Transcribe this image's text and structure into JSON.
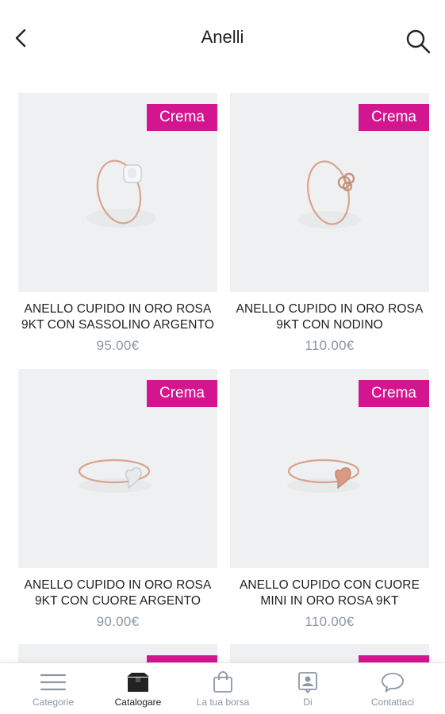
{
  "header": {
    "title": "Anelli",
    "back_icon": "chevron-left-icon",
    "search_icon": "search-icon"
  },
  "colors": {
    "badge": "#d3168f",
    "price": "#8b97a3",
    "image_bg": "#eef0f2"
  },
  "products": [
    {
      "name": "ANELLO CUPIDO IN ORO ROSA 9KT CON SASSOLINO ARGENTO",
      "price": "95.00€",
      "badge": "Crema",
      "charm": "stone"
    },
    {
      "name": "ANELLO CUPIDO IN ORO ROSA 9KT CON NODINO",
      "price": "110.00€",
      "badge": "Crema",
      "charm": "knot"
    },
    {
      "name": "ANELLO CUPIDO IN ORO ROSA 9KT CON CUORE ARGENTO",
      "price": "90.00€",
      "badge": "Crema",
      "charm": "silver-heart"
    },
    {
      "name": "ANELLO CUPIDO CON CUORE MINI IN ORO ROSA 9KT",
      "price": "110.00€",
      "badge": "Crema",
      "charm": "rose-heart"
    }
  ],
  "tabbar": {
    "items": [
      {
        "label": "Categorie",
        "icon": "menu-icon",
        "active": false
      },
      {
        "label": "Catalogare",
        "icon": "box-icon",
        "active": true
      },
      {
        "label": "La tua borsa",
        "icon": "shopping-bag-icon",
        "active": false
      },
      {
        "label": "Di",
        "icon": "contact-card-icon",
        "active": false
      },
      {
        "label": "Contattaci",
        "icon": "chat-bubble-icon",
        "active": false
      }
    ]
  }
}
